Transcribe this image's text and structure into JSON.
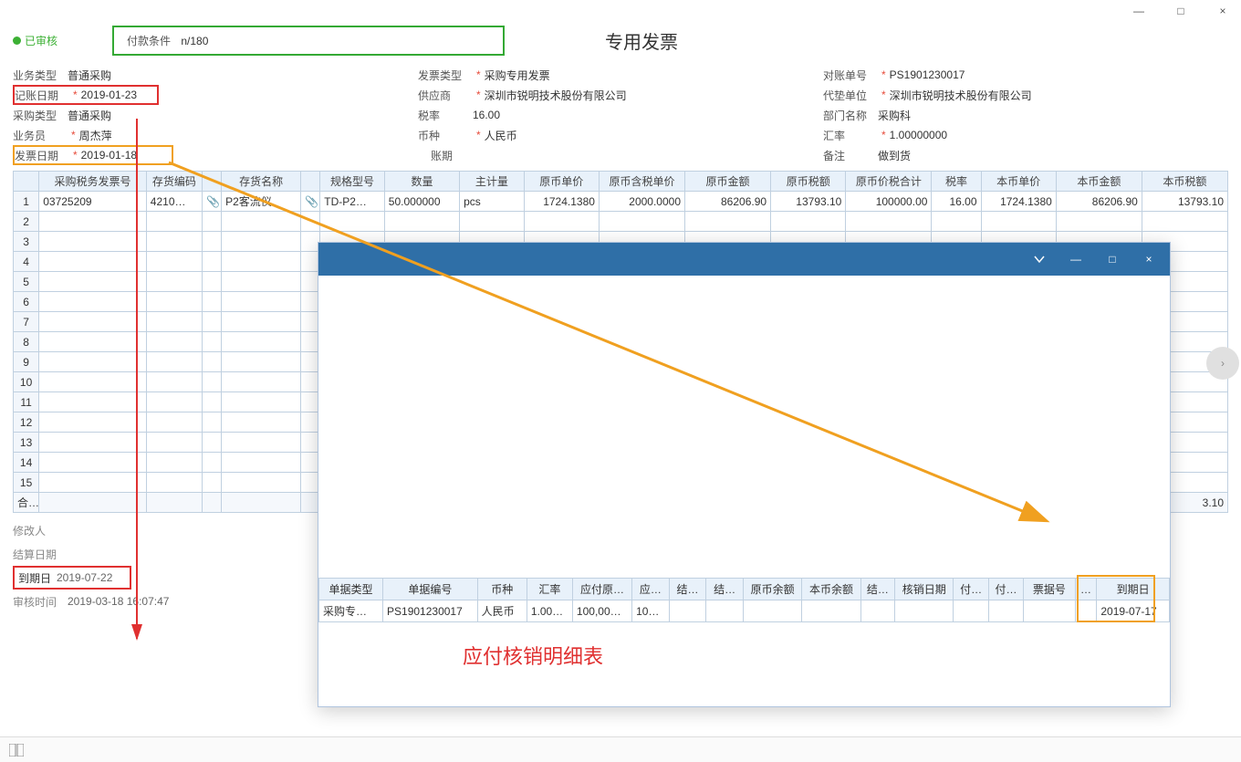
{
  "window_controls": {
    "min": "—",
    "max": "□",
    "close": "×"
  },
  "approved": "已审核",
  "payment_terms_label": "付款条件",
  "payment_terms_value": "n/180",
  "title": "专用发票",
  "col1": {
    "biz_type_label": "业务类型",
    "biz_type": "普通采购",
    "book_date_label": "记账日期",
    "book_date": "2019-01-23",
    "purchase_type_label": "采购类型",
    "purchase_type": "普通采购",
    "clerk_label": "业务员",
    "clerk": "周杰萍",
    "invoice_date_label": "发票日期",
    "invoice_date": "2019-01-18"
  },
  "col2": {
    "inv_type_label": "发票类型",
    "inv_type": "采购专用发票",
    "supplier_label": "供应商",
    "supplier": "深圳市锐明技术股份有限公司",
    "tax_rate_label": "税率",
    "tax_rate": "16.00",
    "currency_label": "币种",
    "currency": "人民币",
    "period_label": "账期",
    "period": ""
  },
  "col3": {
    "recon_no_label": "对账单号",
    "recon_no": "PS1901230017",
    "advance_unit_label": "代垫单位",
    "advance_unit": "深圳市锐明技术股份有限公司",
    "dept_label": "部门名称",
    "dept": "采购科",
    "rate_label": "汇率",
    "rate": "1.00000000",
    "note_label": "备注",
    "note": "做到货"
  },
  "main_headers": [
    "",
    "采购税务发票号",
    "存货编码",
    "",
    "存货名称",
    "",
    "规格型号",
    "数量",
    "主计量",
    "原币单价",
    "原币含税单价",
    "原币金额",
    "原币税额",
    "原币价税合计",
    "税率",
    "本币单价",
    "本币金额",
    "本币税额"
  ],
  "main_row": [
    "1",
    "03725209",
    "4210…",
    "📎",
    "P2客流仪",
    "📎",
    "TD-P2…",
    "50.000000",
    "pcs",
    "1724.1380",
    "2000.0000",
    "86206.90",
    "13793.10",
    "100000.00",
    "16.00",
    "1724.1380",
    "86206.90",
    "13793.10"
  ],
  "empty_rows": [
    "2",
    "3",
    "4",
    "5",
    "6",
    "7",
    "8",
    "9",
    "10",
    "11",
    "12",
    "13",
    "14",
    "15"
  ],
  "sum_label": "合计",
  "sum_tail": "3.10",
  "footer": {
    "modifier_label": "修改人",
    "modifier": "",
    "settle_date_label": "结算日期",
    "settle_date": "",
    "due_date_label": "到期日",
    "due_date": "2019-07-22",
    "audit_time_label": "审核时间",
    "audit_time": "2019-03-18 16:07:47"
  },
  "popup_headers": [
    "单据类型",
    "单据编号",
    "币种",
    "汇率",
    "应付原…",
    "应…",
    "结…",
    "结…",
    "原币余额",
    "本币余额",
    "结…",
    "核销日期",
    "付…",
    "付…",
    "票据号",
    "…",
    "到期日"
  ],
  "popup_row": [
    "采购专…",
    "PS1901230017",
    "人民币",
    "1.00…",
    "100,00…",
    "10…",
    "",
    "",
    "",
    "",
    "",
    "",
    "",
    "",
    "",
    "",
    "2019-07-17"
  ],
  "popup_caption": "应付核销明细表"
}
